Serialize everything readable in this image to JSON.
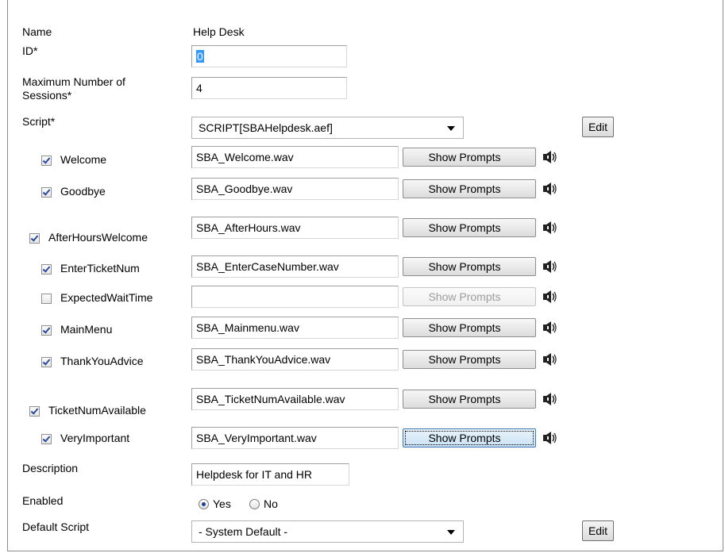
{
  "form": {
    "name": {
      "label": "Name",
      "value": "Help Desk"
    },
    "id": {
      "label": "ID*",
      "value": "0"
    },
    "max_sessions": {
      "label_line1": "Maximum Number of",
      "label_line2": "Sessions*",
      "value": "4"
    },
    "script": {
      "label": "Script*",
      "value": "SCRIPT[SBAHelpdesk.aef]",
      "edit_label": "Edit"
    },
    "prompts": [
      {
        "label": "Welcome",
        "checked": true,
        "file": "SBA_Welcome.wav",
        "button": "Show Prompts",
        "enabled": true
      },
      {
        "label": "Goodbye",
        "checked": true,
        "file": "SBA_Goodbye.wav",
        "button": "Show Prompts",
        "enabled": true
      },
      {
        "label": "AfterHoursWelcome",
        "checked": true,
        "file": "SBA_AfterHours.wav",
        "button": "Show Prompts",
        "enabled": true
      },
      {
        "label": "EnterTicketNum",
        "checked": true,
        "file": "SBA_EnterCaseNumber.wav",
        "button": "Show Prompts",
        "enabled": true
      },
      {
        "label": "ExpectedWaitTime",
        "checked": false,
        "file": "",
        "button": "Show Prompts",
        "enabled": false
      },
      {
        "label": "MainMenu",
        "checked": true,
        "file": "SBA_Mainmenu.wav",
        "button": "Show Prompts",
        "enabled": true
      },
      {
        "label": "ThankYouAdvice",
        "checked": true,
        "file": "SBA_ThankYouAdvice.wav",
        "button": "Show Prompts",
        "enabled": true
      },
      {
        "label": "TicketNumAvailable",
        "checked": true,
        "file": "SBA_TicketNumAvailable.wav",
        "button": "Show Prompts",
        "enabled": true
      },
      {
        "label": "VeryImportant",
        "checked": true,
        "file": "SBA_VeryImportant.wav",
        "button": "Show Prompts",
        "enabled": true,
        "focused": true
      }
    ],
    "description": {
      "label": "Description",
      "value": "Helpdesk for IT and HR"
    },
    "enabled": {
      "label": "Enabled",
      "yes": "Yes",
      "no": "No",
      "selected": "Yes"
    },
    "default_script": {
      "label": "Default Script",
      "value": "- System Default -",
      "edit_label": "Edit"
    }
  },
  "icons": {
    "prompt_play": "speaker-icon"
  }
}
